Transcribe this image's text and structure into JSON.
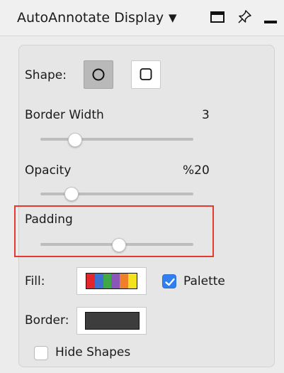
{
  "window": {
    "title": "AutoAnnotate Display",
    "icons": [
      "dropdown-caret-icon",
      "maximize-window-icon",
      "pin-icon",
      "minimize-icon"
    ]
  },
  "shape": {
    "label": "Shape:",
    "options": [
      "ellipse",
      "rectangle"
    ],
    "selected": "ellipse"
  },
  "border_width": {
    "label": "Border Width",
    "value": "3",
    "slider_fraction": 0.22
  },
  "opacity": {
    "label": "Opacity",
    "value": "%20",
    "slider_fraction": 0.2
  },
  "padding": {
    "label": "Padding",
    "slider_fraction": 0.51,
    "highlighted": true,
    "highlight_color": "#e63a30"
  },
  "fill": {
    "label": "Fill:",
    "palette_colors": [
      "#e3262b",
      "#3b6fd0",
      "#3fa746",
      "#8a56b8",
      "#f07f2a",
      "#f4e21c"
    ]
  },
  "palette_toggle": {
    "label": "Palette",
    "checked": true
  },
  "border": {
    "label": "Border:",
    "color": "#3d3d3d"
  },
  "hide_shapes": {
    "label": "Hide Shapes",
    "checked": false
  },
  "colors": {
    "accent": "#2f7ff0"
  }
}
